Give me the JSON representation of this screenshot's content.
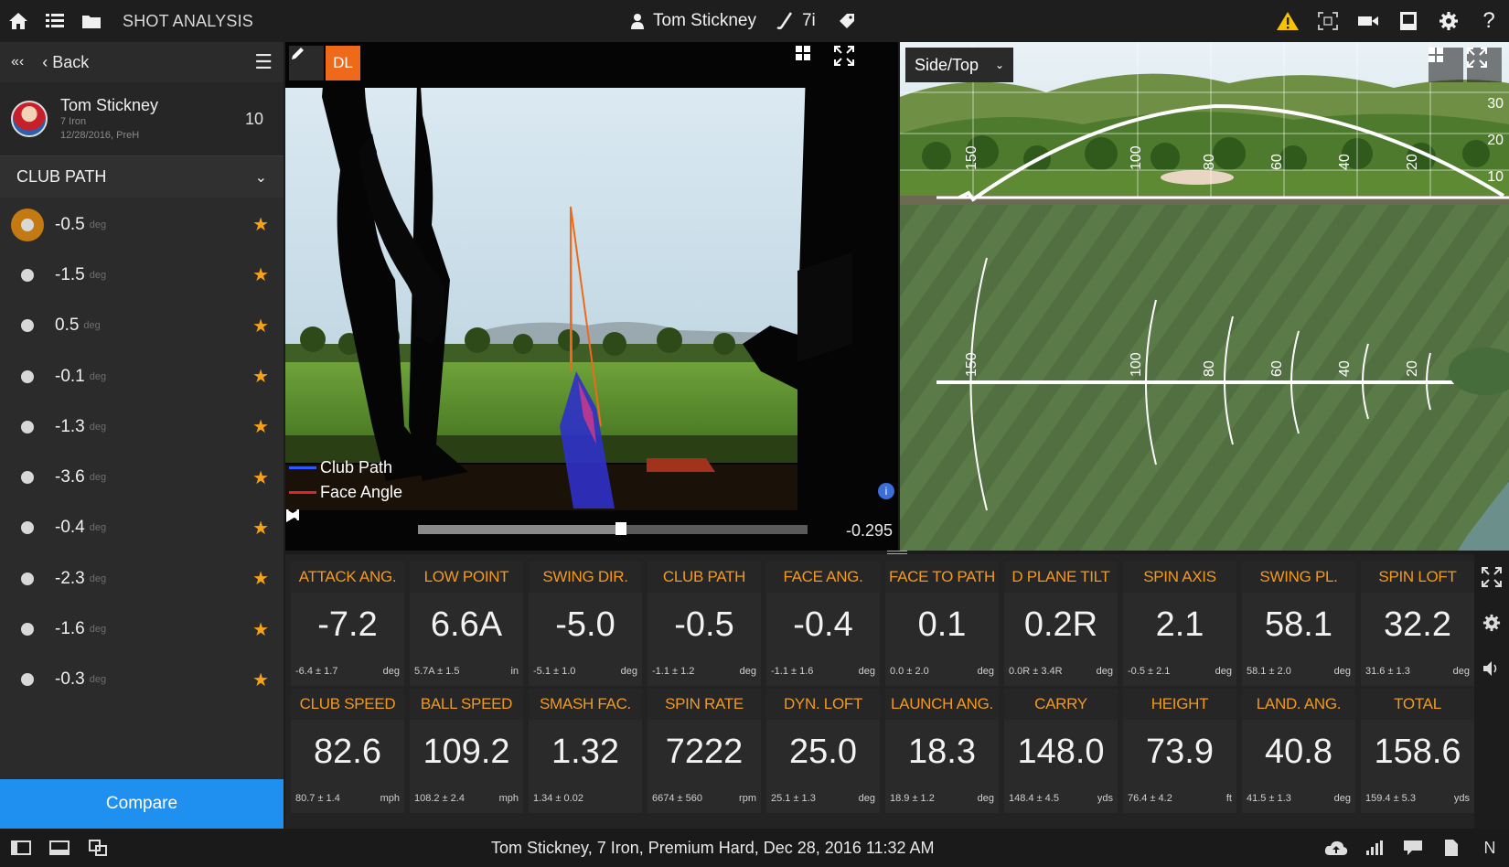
{
  "topbar": {
    "title": "SHOT ANALYSIS",
    "player_name": "Tom Stickney",
    "club": "7i",
    "icons": [
      "home-icon",
      "list-icon",
      "folder-icon",
      "person-icon",
      "club-icon",
      "tag-icon",
      "warning-icon",
      "capture-icon",
      "camera-icon",
      "book-icon",
      "gear-icon",
      "help-icon"
    ]
  },
  "sidebar": {
    "back_label": "Back",
    "player": {
      "name": "Tom Stickney",
      "club": "7 Iron",
      "meta": "12/28/2016, PreH",
      "count": "10"
    },
    "section_title": "CLUB PATH",
    "unit": "deg",
    "shots": [
      "-0.5",
      "-1.5",
      "0.5",
      "-0.1",
      "-1.3",
      "-3.6",
      "-0.4",
      "-2.3",
      "-1.6",
      "-0.3"
    ],
    "selected_index": 0,
    "compare_label": "Compare"
  },
  "video": {
    "dl_label": "DL",
    "legend": [
      {
        "label": "Club Path",
        "color": "#2b5bff"
      },
      {
        "label": "Face Angle",
        "color": "#e0242a"
      }
    ],
    "time": "-0.295",
    "progress": 0.52
  },
  "trajectory": {
    "view_label": "Side/Top",
    "height_ticks": [
      "30",
      "20",
      "10"
    ],
    "distance_ticks": [
      "150",
      "100",
      "80",
      "60",
      "40",
      "20"
    ]
  },
  "stats": [
    {
      "label": "ATTACK ANG.",
      "value": "-7.2",
      "range": "-6.4 ± 1.7",
      "unit": "deg"
    },
    {
      "label": "LOW POINT",
      "value": "6.6A",
      "range": "5.7A ± 1.5",
      "unit": "in"
    },
    {
      "label": "SWING DIR.",
      "value": "-5.0",
      "range": "-5.1 ± 1.0",
      "unit": "deg"
    },
    {
      "label": "CLUB PATH",
      "value": "-0.5",
      "range": "-1.1 ± 1.2",
      "unit": "deg"
    },
    {
      "label": "FACE ANG.",
      "value": "-0.4",
      "range": "-1.1 ± 1.6",
      "unit": "deg"
    },
    {
      "label": "FACE TO PATH",
      "value": "0.1",
      "range": "0.0 ± 2.0",
      "unit": "deg"
    },
    {
      "label": "D PLANE TILT",
      "value": "0.2R",
      "range": "0.0R ± 3.4R",
      "unit": "deg"
    },
    {
      "label": "SPIN AXIS",
      "value": "2.1",
      "range": "-0.5 ± 2.1",
      "unit": "deg"
    },
    {
      "label": "SWING PL.",
      "value": "58.1",
      "range": "58.1 ± 2.0",
      "unit": "deg"
    },
    {
      "label": "SPIN LOFT",
      "value": "32.2",
      "range": "31.6 ± 1.3",
      "unit": "deg"
    },
    {
      "label": "CLUB SPEED",
      "value": "82.6",
      "range": "80.7 ± 1.4",
      "unit": "mph"
    },
    {
      "label": "BALL SPEED",
      "value": "109.2",
      "range": "108.2 ± 2.4",
      "unit": "mph"
    },
    {
      "label": "SMASH FAC.",
      "value": "1.32",
      "range": "1.34 ± 0.02",
      "unit": ""
    },
    {
      "label": "SPIN RATE",
      "value": "7222",
      "range": "6674 ± 560",
      "unit": "rpm"
    },
    {
      "label": "DYN. LOFT",
      "value": "25.0",
      "range": "25.1 ± 1.3",
      "unit": "deg"
    },
    {
      "label": "LAUNCH ANG.",
      "value": "18.3",
      "range": "18.9 ± 1.2",
      "unit": "deg"
    },
    {
      "label": "CARRY",
      "value": "148.0",
      "range": "148.4 ± 4.5",
      "unit": "yds"
    },
    {
      "label": "HEIGHT",
      "value": "73.9",
      "range": "76.4 ± 4.2",
      "unit": "ft"
    },
    {
      "label": "LAND. ANG.",
      "value": "40.8",
      "range": "41.5 ± 1.3",
      "unit": "deg"
    },
    {
      "label": "TOTAL",
      "value": "158.6",
      "range": "159.4 ± 5.3",
      "unit": "yds"
    }
  ],
  "statusbar": {
    "text": "Tom Stickney, 7 Iron, Premium Hard, Dec 28, 2016 11:32 AM",
    "right_label": "N"
  }
}
